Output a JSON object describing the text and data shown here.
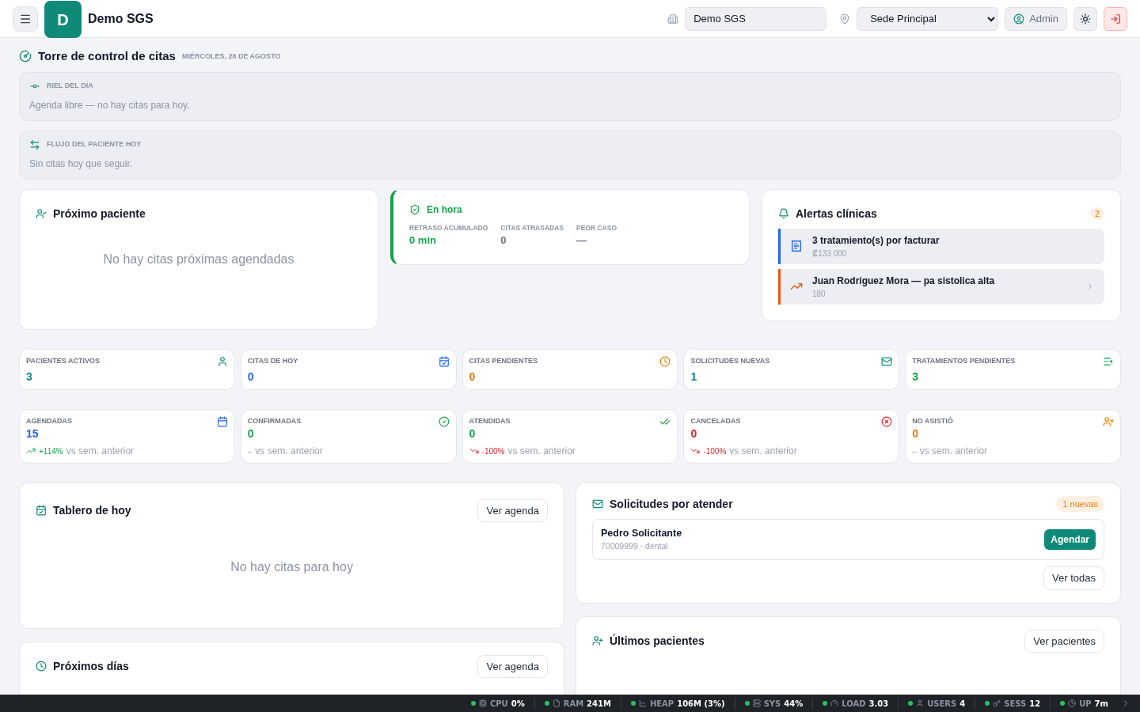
{
  "header": {
    "logo_letter": "D",
    "brand": "Demo SGS",
    "company_field": {
      "value": "Demo SGS"
    },
    "sede_select": {
      "value": "Sede Principal"
    },
    "user_button": "Admin"
  },
  "page": {
    "title": "Torre de control de citas",
    "date": "MIÉRCOLES, 26 DE AGOSTO"
  },
  "riel": {
    "label": "RIEL DEL DÍA",
    "text": "Agenda libre — no hay citas para hoy."
  },
  "flujo": {
    "label": "FLUJO DEL PACIENTE HOY",
    "text": "Sin citas hoy que seguir."
  },
  "proximo_paciente": {
    "title": "Próximo paciente",
    "empty": "No hay citas próximas agendadas"
  },
  "puntualidad": {
    "status": "En hora",
    "metrics": [
      {
        "label": "RETRASO ACUMULADO",
        "value": "0 min",
        "color": "#16a34a"
      },
      {
        "label": "CITAS ATRASADAS",
        "value": "0",
        "color": "#6b7280"
      },
      {
        "label": "PEOR CASO",
        "value": "—",
        "color": "#6b7280"
      }
    ]
  },
  "alertas": {
    "title": "Alertas clínicas",
    "count": "2",
    "items": [
      {
        "kind": "billing",
        "title": "3 tratamiento(s) por facturar",
        "detail": "₡133 000",
        "color": "#2563eb",
        "expandable": false
      },
      {
        "kind": "vital",
        "title": "Juan Rodríguez Mora — pa sistolica alta",
        "detail": "180",
        "color": "#ea580c",
        "expandable": true
      }
    ]
  },
  "kpis": [
    {
      "label": "PACIENTES ACTIVOS",
      "value": "3",
      "color": "#0f8a78"
    },
    {
      "label": "CITAS DE HOY",
      "value": "0",
      "color": "#2563eb"
    },
    {
      "label": "CITAS PENDIENTES",
      "value": "0",
      "color": "#ea7c0c"
    },
    {
      "label": "SOLICITUDES NUEVAS",
      "value": "1",
      "color": "#0f8a78"
    },
    {
      "label": "TRATAMIENTOS PENDIENTES",
      "value": "3",
      "color": "#16a34a"
    }
  ],
  "weekly": [
    {
      "label": "AGENDADAS",
      "value": "15",
      "color": "#2563eb",
      "kind": "up",
      "change": "+114%",
      "suffix": "vs sem. anterior"
    },
    {
      "label": "CONFIRMADAS",
      "value": "0",
      "color": "#16a34a",
      "kind": "flat",
      "change": "–",
      "suffix": "vs sem. anterior"
    },
    {
      "label": "ATENDIDAS",
      "value": "0",
      "color": "#16a34a",
      "kind": "down",
      "change": "-100%",
      "suffix": "vs sem. anterior"
    },
    {
      "label": "CANCELADAS",
      "value": "0",
      "color": "#dc2626",
      "kind": "down",
      "change": "-100%",
      "suffix": "vs sem. anterior"
    },
    {
      "label": "NO ASISTIÓ",
      "value": "0",
      "color": "#ea7c0c",
      "kind": "flat",
      "change": "–",
      "suffix": "vs sem. anterior"
    }
  ],
  "tablero": {
    "title": "Tablero de hoy",
    "button": "Ver agenda",
    "empty": "No hay citas para hoy"
  },
  "proximos_dias": {
    "title": "Próximos días",
    "button": "Ver agenda"
  },
  "solicitudes": {
    "title": "Solicitudes por atender",
    "badge": "1 nuevas",
    "items": [
      {
        "name": "Pedro Solicitante",
        "detail": "70009999 · dental",
        "button": "Agendar"
      }
    ],
    "button": "Ver todas"
  },
  "ultimos": {
    "title": "Últimos pacientes",
    "button": "Ver pacientes"
  },
  "status_bar": [
    {
      "label": "CPU",
      "value": "0%",
      "color": "#22c55e"
    },
    {
      "label": "RAM",
      "value": "241M",
      "color": "#22c55e"
    },
    {
      "label": "HEAP",
      "value": "106M (3%)",
      "color": "#22c55e"
    },
    {
      "label": "SYS",
      "value": "44%",
      "color": "#22c55e"
    },
    {
      "label": "LOAD",
      "value": "3.03",
      "color": "#22c55e"
    },
    {
      "label": "USERS",
      "value": "4",
      "color": "#22c55e"
    },
    {
      "label": "SESS",
      "value": "12",
      "color": "#22c55e"
    },
    {
      "label": "UP",
      "value": "7m",
      "color": "#22c55e"
    }
  ]
}
